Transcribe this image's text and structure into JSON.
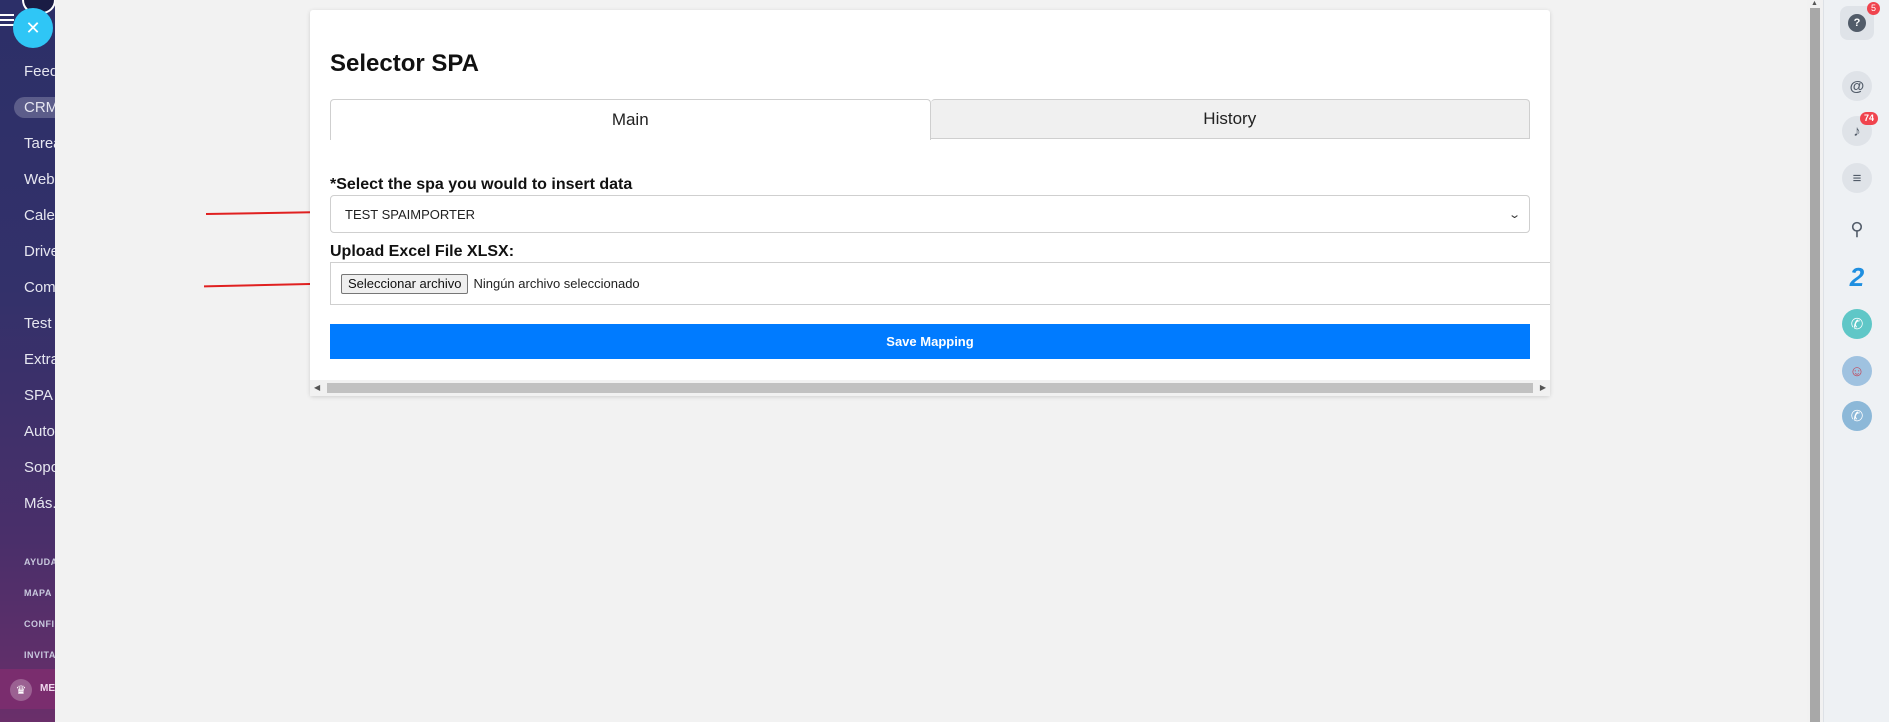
{
  "sidebar": {
    "close_glyph": "✕",
    "items": [
      {
        "label": "Feed"
      },
      {
        "label": "CRM"
      },
      {
        "label": "Tarea"
      },
      {
        "label": "Web"
      },
      {
        "label": "Cale"
      },
      {
        "label": "Drive"
      },
      {
        "label": "Com"
      },
      {
        "label": "Test"
      },
      {
        "label": "Extra"
      },
      {
        "label": "SPA I"
      },
      {
        "label": "Auto"
      },
      {
        "label": "Sopo"
      },
      {
        "label": "Más..."
      }
    ],
    "footer_links": [
      {
        "label": "AYUDA"
      },
      {
        "label": "MAPA"
      },
      {
        "label": "CONFI"
      },
      {
        "label": "INVITA"
      }
    ],
    "user_label": "ME",
    "crown_glyph": "♛"
  },
  "card": {
    "title": "Selector SPA",
    "tabs": [
      {
        "label": "Main",
        "active": true
      },
      {
        "label": "History",
        "active": false
      }
    ],
    "select_label": "*Select the spa you would to insert data",
    "select_value": "TEST SPAIMPORTER",
    "upload_label": "Upload Excel File XLSX:",
    "file_button_label": "Seleccionar archivo",
    "file_status": "Ningún archivo seleccionado",
    "save_label": "Save Mapping"
  },
  "right_panel": {
    "help_badge": "5",
    "notifications_badge": "74",
    "icons": [
      "help-icon",
      "copilot-icon",
      "bell-icon",
      "chat-icon",
      "search-icon",
      "brand-icon",
      "phone-icon",
      "avatar-icon",
      "call-icon"
    ]
  },
  "colors": {
    "accent": "#007bff",
    "sidebar_close": "#2fc6f6",
    "annotation_arrow": "#e02020",
    "badge": "#f0444e"
  }
}
